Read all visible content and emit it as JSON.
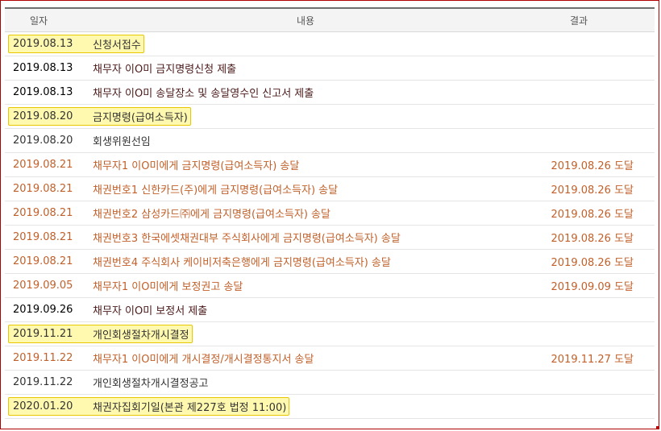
{
  "table": {
    "headers": {
      "date": "일자",
      "content": "내용",
      "result": "결과"
    },
    "rows": [
      {
        "date": "2019.08.13",
        "content": "신청서접수",
        "result": "",
        "style": "plain",
        "highlight": true
      },
      {
        "date": "2019.08.13",
        "content": "채무자 이O미 금지명령신청 제출",
        "result": "",
        "style": "darkred"
      },
      {
        "date": "2019.08.13",
        "content": "채무자 이O미 송달장소 및 송달영수인 신고서 제출",
        "result": "",
        "style": "darkred"
      },
      {
        "date": "2019.08.20",
        "content": "금지명령(급여소득자)",
        "result": "",
        "style": "plain",
        "highlight": true
      },
      {
        "date": "2019.08.20",
        "content": "회생위원선임",
        "result": "",
        "style": "plain"
      },
      {
        "date": "2019.08.21",
        "content": "채무자1 이O미에게 금지명령(급여소득자) 송달",
        "result": "2019.08.26 도달",
        "style": "orange"
      },
      {
        "date": "2019.08.21",
        "content": "채권번호1 신한카드(주)에게 금지명령(급여소득자) 송달",
        "result": "2019.08.26 도달",
        "style": "orange"
      },
      {
        "date": "2019.08.21",
        "content": "채권번호2 삼성카드㈜에게 금지명령(급여소득자) 송달",
        "result": "2019.08.26 도달",
        "style": "orange"
      },
      {
        "date": "2019.08.21",
        "content": "채권번호3 한국에셋채권대부 주식회사에게 금지명령(급여소득자) 송달",
        "result": "2019.08.26 도달",
        "style": "orange"
      },
      {
        "date": "2019.08.21",
        "content": "채권번호4 주식회사 케이비저축은행에게 금지명령(급여소득자) 송달",
        "result": "2019.08.26 도달",
        "style": "orange"
      },
      {
        "date": "2019.09.05",
        "content": "채무자1 이O미에게 보정권고 송달",
        "result": "2019.09.09 도달",
        "style": "orange"
      },
      {
        "date": "2019.09.26",
        "content": "채무자 이O미 보정서 제출",
        "result": "",
        "style": "darkred"
      },
      {
        "date": "2019.11.21",
        "content": "개인회생절차개시결정",
        "result": "",
        "style": "plain",
        "highlight": true
      },
      {
        "date": "2019.11.22",
        "content": "채무자1 이O미에게 개시결정/개시결정통지서 송달",
        "result": "2019.11.27 도달",
        "style": "orange"
      },
      {
        "date": "2019.11.22",
        "content": "개인회생절차개시결정공고",
        "result": "",
        "style": "plain"
      },
      {
        "date": "2020.01.20",
        "content": "채권자집회기일(본관 제227호 법정 11:00)",
        "result": "",
        "style": "plain",
        "highlight": true
      }
    ]
  }
}
